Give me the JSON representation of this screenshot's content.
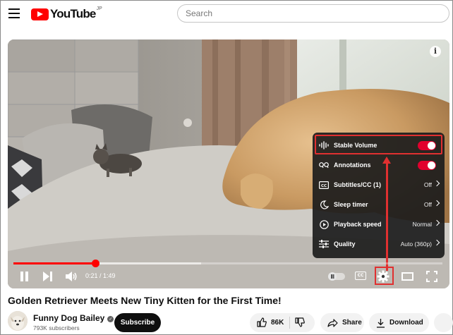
{
  "header": {
    "logo_text": "YouTube",
    "logo_superscript": "JP",
    "search_placeholder": "Search"
  },
  "player": {
    "info_icon": "i",
    "current_time": "0:21",
    "duration": "1:49",
    "time_display": "0:21 / 1:49",
    "progress_fraction": 0.19,
    "cc_label": "CC",
    "settings_menu": [
      {
        "label": "Stable Volume",
        "icon": "waveform-icon",
        "type": "toggle",
        "on": true
      },
      {
        "label": "Annotations",
        "icon": "annotations-icon",
        "type": "toggle",
        "on": true
      },
      {
        "label": "Subtitles/CC (1)",
        "icon": "cc-icon",
        "type": "value",
        "value": "Off"
      },
      {
        "label": "Sleep timer",
        "icon": "sleep-timer-icon",
        "type": "value",
        "value": "Off"
      },
      {
        "label": "Playback speed",
        "icon": "playback-speed-icon",
        "type": "value",
        "value": "Normal"
      },
      {
        "label": "Quality",
        "icon": "quality-sliders-icon",
        "type": "value",
        "value": "Auto (360p)"
      }
    ]
  },
  "video": {
    "title": "Golden Retriever Meets New Tiny Kitten for the First Time!",
    "channel_name": "Funny Dog Bailey",
    "subscribers": "793K subscribers",
    "subscribe_label": "Subscribe",
    "like_count": "86K",
    "share_label": "Share",
    "download_label": "Download"
  },
  "colors": {
    "brand_red": "#ff0000",
    "toggle_on": "#e1002d",
    "annotation_red": "#e03030"
  }
}
